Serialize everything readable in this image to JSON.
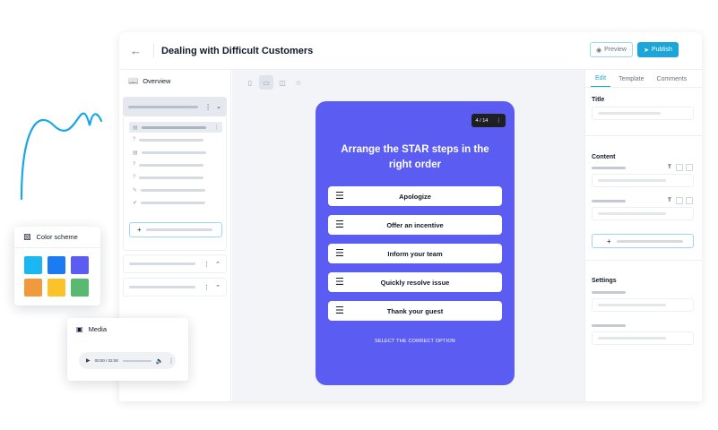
{
  "header": {
    "title": "Dealing with Difficult Customers",
    "preview_label": "Preview",
    "publish_label": "Publish"
  },
  "sidebar": {
    "overview_label": "Overview"
  },
  "slide": {
    "counter": "4 / 14",
    "question": "Arrange the STAR steps in the right order",
    "options": [
      "Apologize",
      "Offer an incentive",
      "Inform your team",
      "Quickly resolve issue",
      "Thank your guest"
    ],
    "instruction": "SELECT THE CORRECT OPTION",
    "background_color": "#5b5cf2"
  },
  "right_panel": {
    "tabs": [
      "Edit",
      "Template",
      "Comments"
    ],
    "title_label": "Title",
    "content_label": "Content",
    "settings_label": "Settings"
  },
  "color_scheme": {
    "title": "Color scheme",
    "colors": [
      "#1ab8f3",
      "#1a7cf0",
      "#5b5cf2",
      "#f0993d",
      "#fbc22a",
      "#58b970"
    ]
  },
  "media": {
    "title": "Media",
    "time": "00:00 / 02:00"
  },
  "icons": {
    "back": "arrow-left-icon",
    "book": "book-icon",
    "eye": "eye-icon",
    "send": "send-icon",
    "paint": "paint-roller-icon",
    "media": "media-icon"
  }
}
